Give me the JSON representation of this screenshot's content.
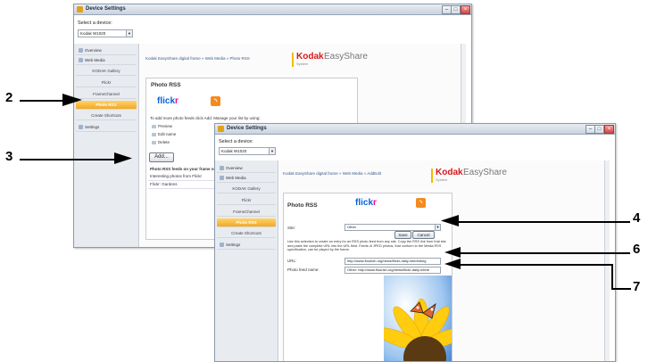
{
  "window_title": "Device Settings",
  "select_device_label": "Select a device:",
  "device_value": "Kodak W1020",
  "sidebar": {
    "items": [
      {
        "label": "Overview"
      },
      {
        "label": "Web Media"
      },
      {
        "label": "KODAK Gallery"
      },
      {
        "label": "Flickr"
      },
      {
        "label": "FrameChannel"
      },
      {
        "label": "Photo RSS"
      },
      {
        "label": "Create Shortcuts"
      },
      {
        "label": "Settings"
      }
    ]
  },
  "breadcrumb_back": "Kodak EasyShare digital frame » Web Media » Photo RSS",
  "breadcrumb_front": "Kodak EasyShare digital frame » Web Media » AddEdit",
  "brand": {
    "kodak": "Kodak",
    "easyshare": "EasyShare",
    "system": "System"
  },
  "panel_title": "Photo RSS",
  "flickr": {
    "flick": "flick",
    "r": "r"
  },
  "back_window": {
    "help_text": "To add more photo feeds click Add. Manage your list by using:",
    "actions": [
      "Preview",
      "Edit name",
      "Delete"
    ],
    "add_button": "Add...",
    "feeds_heading": "Photo RSS feeds on your frame now:",
    "feeds": [
      "Interesting photos from Flickr",
      "Flickr: Gardens"
    ]
  },
  "front_window": {
    "site_label": "Site:",
    "site_value": "Other",
    "save_button": "Save",
    "cancel_button": "Cancel",
    "description": "Use this selection to create an entry for an RSS photo feed from any site. Copy the RSS link from that site and paste the complete URL into the URL field. Feeds of JPEG photos, that conform to the Media RSS specification, can be played by the frame.",
    "url_label": "URL:",
    "url_value": "http://www.flourish.org/news/flickr-daily-interesting",
    "name_label": "Photo feed name:",
    "name_value": "Other: http://www.flourish.org/news/flickr-daily-intere"
  },
  "callouts": [
    "2",
    "3",
    "4",
    "6",
    "7"
  ],
  "colors": {
    "accent": "#f2a922",
    "kodak_red": "#d7161b",
    "flickr_blue": "#0063dc",
    "flickr_pink": "#ff0084"
  }
}
